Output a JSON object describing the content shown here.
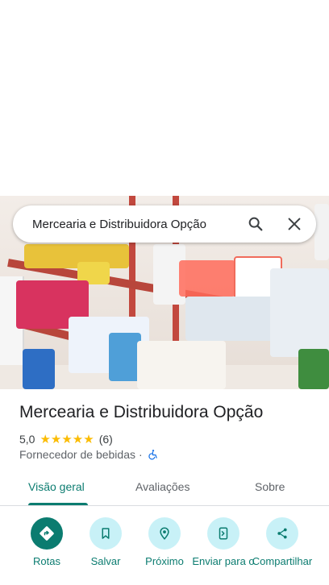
{
  "search": {
    "query": "Mercearia e Distribuidora Opção"
  },
  "place": {
    "title": "Mercearia e Distribuidora Opção",
    "rating": "5,0",
    "stars": "★★★★★",
    "review_count": "(6)",
    "category": "Fornecedor de bebidas",
    "separator": "·"
  },
  "tabs": [
    {
      "label": "Visão geral",
      "active": true
    },
    {
      "label": "Avaliações",
      "active": false
    },
    {
      "label": "Sobre",
      "active": false
    }
  ],
  "actions": [
    {
      "label": "Rotas",
      "icon": "directions-icon"
    },
    {
      "label": "Salvar",
      "icon": "bookmark-icon"
    },
    {
      "label": "Próximo",
      "icon": "nearby-icon"
    },
    {
      "label": "Enviar para o",
      "icon": "send-to-phone-icon"
    },
    {
      "label": "Compartilhar",
      "icon": "share-icon"
    }
  ],
  "colors": {
    "accent": "#0b7c70",
    "chip": "#c8f1f7",
    "star": "#fbbc04"
  }
}
